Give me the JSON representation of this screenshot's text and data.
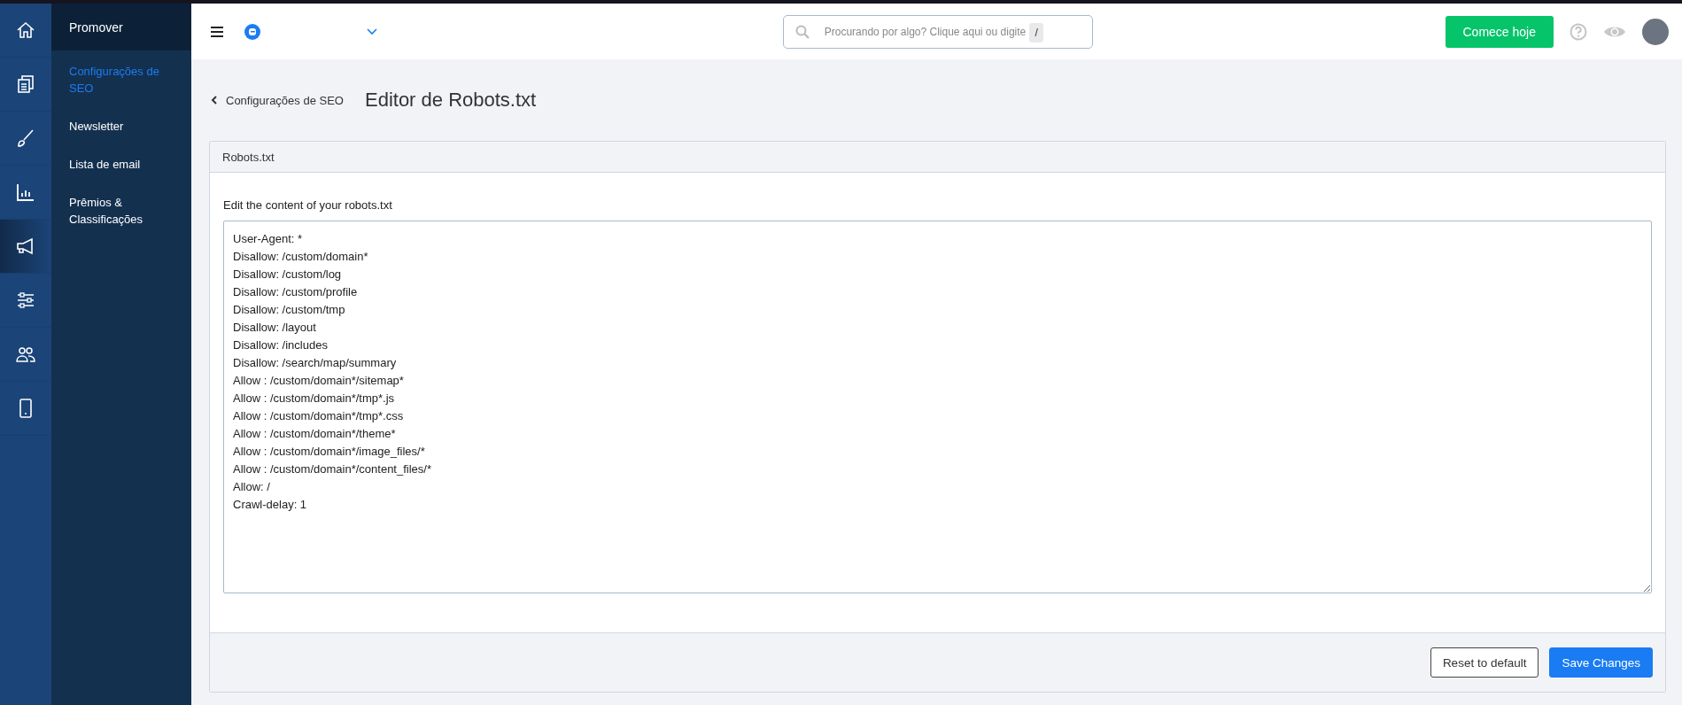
{
  "rail": [
    {
      "selected": false
    },
    {
      "selected": false
    },
    {
      "selected": false
    },
    {
      "selected": false
    },
    {
      "selected": true
    },
    {
      "selected": false
    },
    {
      "selected": false
    },
    {
      "selected": false
    }
  ],
  "submenu": {
    "title": "Promover",
    "items": [
      {
        "label": "Configurações de SEO",
        "selected": true
      },
      {
        "label": "Newsletter",
        "selected": false
      },
      {
        "label": "Lista de email",
        "selected": false
      },
      {
        "label": "Prêmios & Classificações",
        "selected": false
      }
    ]
  },
  "topbar": {
    "search": {
      "placeholder": "Procurando por algo? Clique aqui ou digite",
      "shortcut": "/"
    },
    "cta": "Comece hoje"
  },
  "breadcrumb": {
    "back": "Configurações de SEO",
    "title": "Editor de Robots.txt"
  },
  "card": {
    "title": "Robots.txt",
    "label": "Edit the content of your robots.txt",
    "content": "User-Agent: *\nDisallow: /custom/domain*\nDisallow: /custom/log\nDisallow: /custom/profile\nDisallow: /custom/tmp\nDisallow: /layout\nDisallow: /includes\nDisallow: /search/map/summary\nAllow : /custom/domain*/sitemap*\nAllow : /custom/domain*/tmp*.js\nAllow : /custom/domain*/tmp*.css\nAllow : /custom/domain*/theme*\nAllow : /custom/domain*/image_files/*\nAllow : /custom/domain*/content_files/*\nAllow: /\nCrawl-delay: 1",
    "buttons": [
      {
        "label": "Reset to default",
        "kind": "secondary"
      },
      {
        "label": "Save Changes",
        "kind": "primary"
      }
    ]
  }
}
